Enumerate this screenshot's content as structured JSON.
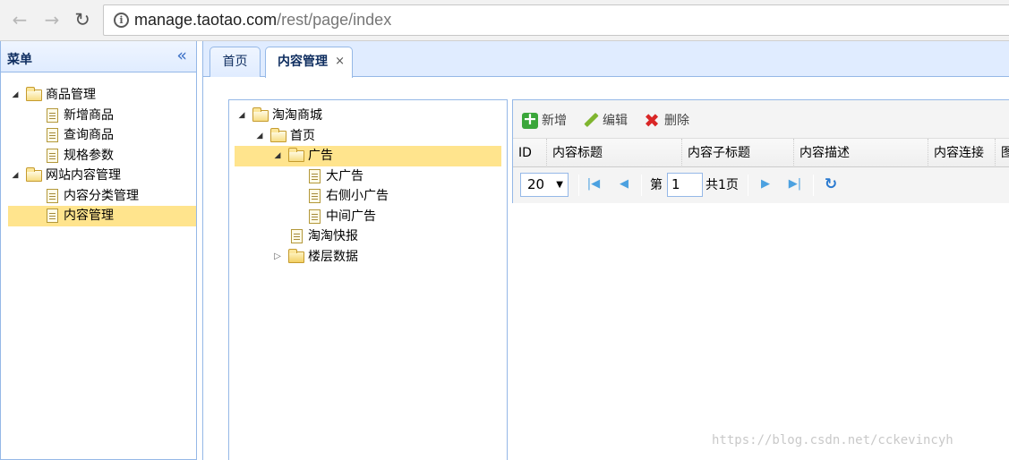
{
  "browser": {
    "url_host": "manage.taotao.com",
    "url_path": "/rest/page/index",
    "back_glyph": "←",
    "forward_glyph": "→",
    "reload_glyph": "↻"
  },
  "menu": {
    "title": "菜单",
    "collapse_glyph": "«",
    "items": [
      {
        "label": "商品管理",
        "type": "folder"
      },
      {
        "label": "新增商品",
        "type": "file"
      },
      {
        "label": "查询商品",
        "type": "file"
      },
      {
        "label": "规格参数",
        "type": "file"
      },
      {
        "label": "网站内容管理",
        "type": "folder"
      },
      {
        "label": "内容分类管理",
        "type": "file"
      },
      {
        "label": "内容管理",
        "type": "file",
        "selected": true
      }
    ]
  },
  "tabs": [
    {
      "label": "首页"
    },
    {
      "label": "内容管理",
      "close": "×",
      "active": true
    }
  ],
  "content_tree": [
    {
      "label": "淘淘商城",
      "type": "folder"
    },
    {
      "label": "首页",
      "type": "folder"
    },
    {
      "label": "广告",
      "type": "folder",
      "selected": true
    },
    {
      "label": "大广告",
      "type": "file"
    },
    {
      "label": "右侧小广告",
      "type": "file"
    },
    {
      "label": "中间广告",
      "type": "file"
    },
    {
      "label": "淘淘快报",
      "type": "file"
    },
    {
      "label": "楼层数据",
      "type": "folder",
      "collapsed": true
    }
  ],
  "toolbar": {
    "add_label": "新增",
    "edit_label": "编辑",
    "delete_label": "删除"
  },
  "grid": {
    "columns": [
      "ID",
      "内容标题",
      "内容子标题",
      "内容描述",
      "内容连接",
      "图"
    ]
  },
  "pager": {
    "page_size": "20",
    "page_prefix": "第",
    "page_value": "1",
    "page_total": "共1页"
  },
  "watermark": "https://blog.csdn.net/cckevincyh"
}
